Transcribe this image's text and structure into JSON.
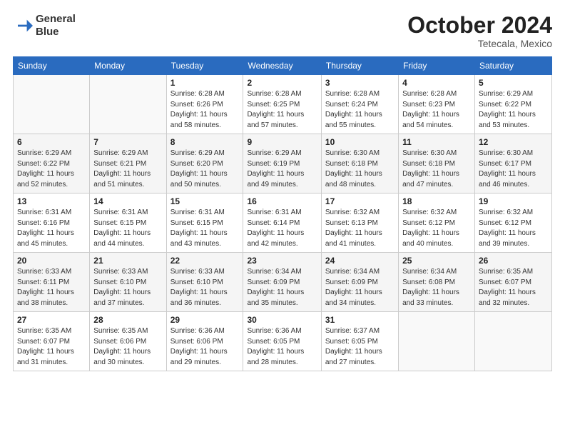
{
  "header": {
    "logo_line1": "General",
    "logo_line2": "Blue",
    "month": "October 2024",
    "location": "Tetecala, Mexico"
  },
  "days_of_week": [
    "Sunday",
    "Monday",
    "Tuesday",
    "Wednesday",
    "Thursday",
    "Friday",
    "Saturday"
  ],
  "weeks": [
    [
      {
        "day": "",
        "info": ""
      },
      {
        "day": "",
        "info": ""
      },
      {
        "day": "1",
        "info": "Sunrise: 6:28 AM\nSunset: 6:26 PM\nDaylight: 11 hours\nand 58 minutes."
      },
      {
        "day": "2",
        "info": "Sunrise: 6:28 AM\nSunset: 6:25 PM\nDaylight: 11 hours\nand 57 minutes."
      },
      {
        "day": "3",
        "info": "Sunrise: 6:28 AM\nSunset: 6:24 PM\nDaylight: 11 hours\nand 55 minutes."
      },
      {
        "day": "4",
        "info": "Sunrise: 6:28 AM\nSunset: 6:23 PM\nDaylight: 11 hours\nand 54 minutes."
      },
      {
        "day": "5",
        "info": "Sunrise: 6:29 AM\nSunset: 6:22 PM\nDaylight: 11 hours\nand 53 minutes."
      }
    ],
    [
      {
        "day": "6",
        "info": "Sunrise: 6:29 AM\nSunset: 6:22 PM\nDaylight: 11 hours\nand 52 minutes."
      },
      {
        "day": "7",
        "info": "Sunrise: 6:29 AM\nSunset: 6:21 PM\nDaylight: 11 hours\nand 51 minutes."
      },
      {
        "day": "8",
        "info": "Sunrise: 6:29 AM\nSunset: 6:20 PM\nDaylight: 11 hours\nand 50 minutes."
      },
      {
        "day": "9",
        "info": "Sunrise: 6:29 AM\nSunset: 6:19 PM\nDaylight: 11 hours\nand 49 minutes."
      },
      {
        "day": "10",
        "info": "Sunrise: 6:30 AM\nSunset: 6:18 PM\nDaylight: 11 hours\nand 48 minutes."
      },
      {
        "day": "11",
        "info": "Sunrise: 6:30 AM\nSunset: 6:18 PM\nDaylight: 11 hours\nand 47 minutes."
      },
      {
        "day": "12",
        "info": "Sunrise: 6:30 AM\nSunset: 6:17 PM\nDaylight: 11 hours\nand 46 minutes."
      }
    ],
    [
      {
        "day": "13",
        "info": "Sunrise: 6:31 AM\nSunset: 6:16 PM\nDaylight: 11 hours\nand 45 minutes."
      },
      {
        "day": "14",
        "info": "Sunrise: 6:31 AM\nSunset: 6:15 PM\nDaylight: 11 hours\nand 44 minutes."
      },
      {
        "day": "15",
        "info": "Sunrise: 6:31 AM\nSunset: 6:15 PM\nDaylight: 11 hours\nand 43 minutes."
      },
      {
        "day": "16",
        "info": "Sunrise: 6:31 AM\nSunset: 6:14 PM\nDaylight: 11 hours\nand 42 minutes."
      },
      {
        "day": "17",
        "info": "Sunrise: 6:32 AM\nSunset: 6:13 PM\nDaylight: 11 hours\nand 41 minutes."
      },
      {
        "day": "18",
        "info": "Sunrise: 6:32 AM\nSunset: 6:12 PM\nDaylight: 11 hours\nand 40 minutes."
      },
      {
        "day": "19",
        "info": "Sunrise: 6:32 AM\nSunset: 6:12 PM\nDaylight: 11 hours\nand 39 minutes."
      }
    ],
    [
      {
        "day": "20",
        "info": "Sunrise: 6:33 AM\nSunset: 6:11 PM\nDaylight: 11 hours\nand 38 minutes."
      },
      {
        "day": "21",
        "info": "Sunrise: 6:33 AM\nSunset: 6:10 PM\nDaylight: 11 hours\nand 37 minutes."
      },
      {
        "day": "22",
        "info": "Sunrise: 6:33 AM\nSunset: 6:10 PM\nDaylight: 11 hours\nand 36 minutes."
      },
      {
        "day": "23",
        "info": "Sunrise: 6:34 AM\nSunset: 6:09 PM\nDaylight: 11 hours\nand 35 minutes."
      },
      {
        "day": "24",
        "info": "Sunrise: 6:34 AM\nSunset: 6:09 PM\nDaylight: 11 hours\nand 34 minutes."
      },
      {
        "day": "25",
        "info": "Sunrise: 6:34 AM\nSunset: 6:08 PM\nDaylight: 11 hours\nand 33 minutes."
      },
      {
        "day": "26",
        "info": "Sunrise: 6:35 AM\nSunset: 6:07 PM\nDaylight: 11 hours\nand 32 minutes."
      }
    ],
    [
      {
        "day": "27",
        "info": "Sunrise: 6:35 AM\nSunset: 6:07 PM\nDaylight: 11 hours\nand 31 minutes."
      },
      {
        "day": "28",
        "info": "Sunrise: 6:35 AM\nSunset: 6:06 PM\nDaylight: 11 hours\nand 30 minutes."
      },
      {
        "day": "29",
        "info": "Sunrise: 6:36 AM\nSunset: 6:06 PM\nDaylight: 11 hours\nand 29 minutes."
      },
      {
        "day": "30",
        "info": "Sunrise: 6:36 AM\nSunset: 6:05 PM\nDaylight: 11 hours\nand 28 minutes."
      },
      {
        "day": "31",
        "info": "Sunrise: 6:37 AM\nSunset: 6:05 PM\nDaylight: 11 hours\nand 27 minutes."
      },
      {
        "day": "",
        "info": ""
      },
      {
        "day": "",
        "info": ""
      }
    ]
  ]
}
